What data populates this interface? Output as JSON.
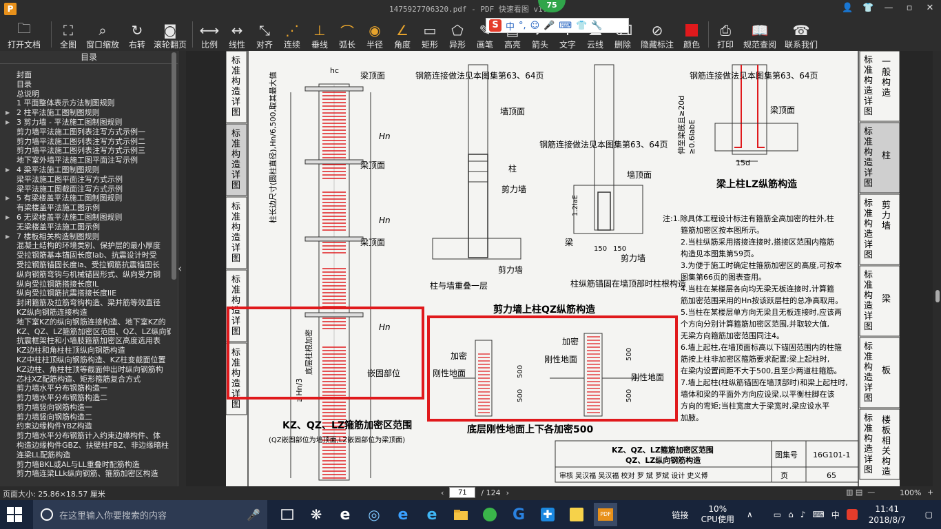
{
  "window": {
    "title": "1475927706320.pdf - PDF 快速看图 v1.9",
    "logo": "P",
    "badge": "75"
  },
  "toolbar": {
    "items": [
      {
        "label": "打开文档",
        "icon": "folder-icon"
      },
      {
        "label": "全图",
        "icon": "fit-icon"
      },
      {
        "label": "窗口缩放",
        "icon": "zoom-icon"
      },
      {
        "label": "右转",
        "icon": "rotate-icon"
      },
      {
        "label": "滚轮翻页",
        "icon": "mouse-icon"
      },
      {
        "label": "比例",
        "icon": "scale-icon"
      },
      {
        "label": "线性",
        "icon": "linear-icon"
      },
      {
        "label": "对齐",
        "icon": "align-icon"
      },
      {
        "label": "连续",
        "icon": "continuous-icon"
      },
      {
        "label": "垂线",
        "icon": "perpendicular-icon"
      },
      {
        "label": "弧长",
        "icon": "arc-icon"
      },
      {
        "label": "半径",
        "icon": "radius-icon"
      },
      {
        "label": "角度",
        "icon": "angle-icon"
      },
      {
        "label": "矩形",
        "icon": "rect-icon"
      },
      {
        "label": "异形",
        "icon": "polygon-icon"
      },
      {
        "label": "画笔",
        "icon": "pen-icon"
      },
      {
        "label": "高亮",
        "icon": "highlight-icon"
      },
      {
        "label": "箭头",
        "icon": "arrow-icon"
      },
      {
        "label": "文字",
        "icon": "text-icon"
      },
      {
        "label": "云线",
        "icon": "cloud-icon"
      },
      {
        "label": "删除",
        "icon": "eraser-icon"
      },
      {
        "label": "隐藏标注",
        "icon": "hide-icon"
      },
      {
        "label": "颜色",
        "icon": "color-icon",
        "color": "#e0191c"
      },
      {
        "label": "打印",
        "icon": "printer-icon"
      },
      {
        "label": "规范查阅",
        "icon": "book-icon"
      },
      {
        "label": "联系我们",
        "icon": "user-icon"
      }
    ]
  },
  "ime": {
    "mode": "中",
    "punct": "°,"
  },
  "sidebar": {
    "title": "目录",
    "items": [
      {
        "text": "封面",
        "indent": 1
      },
      {
        "text": "目录",
        "indent": 1
      },
      {
        "text": "总说明",
        "indent": 1
      },
      {
        "text": "1 平面整体表示方法制图规则",
        "indent": 1
      },
      {
        "text": "2 柱平法施工图制图规则",
        "indent": 1,
        "arrow": true
      },
      {
        "text": "3 剪力墙 - 平法施工图制图规则",
        "indent": 1,
        "arrow": true
      },
      {
        "text": "剪力墙平法施工图列表注写方式示例一",
        "indent": 1
      },
      {
        "text": "剪力墙平法施工图列表注写方式示例二",
        "indent": 1
      },
      {
        "text": "剪力墙平法施工图列表注写方式示例三",
        "indent": 1
      },
      {
        "text": "地下室外墙平法施工图平面注写示例",
        "indent": 1
      },
      {
        "text": "4 梁平法施工图制图规则",
        "indent": 1,
        "arrow": true
      },
      {
        "text": "梁平法施工图平面注写方式示例",
        "indent": 1
      },
      {
        "text": "梁平法施工图截面注写方式示例",
        "indent": 1
      },
      {
        "text": "5 有梁楼盖平法施工图制图规则",
        "indent": 1,
        "arrow": true
      },
      {
        "text": "有梁楼盖平法施工图示例",
        "indent": 1
      },
      {
        "text": "6 无梁楼盖平法施工图制图规则",
        "indent": 1,
        "arrow": true
      },
      {
        "text": "无梁楼盖平法施工图示例",
        "indent": 1
      },
      {
        "text": "7 楼板相关构造制图规则",
        "indent": 1,
        "arrow": true
      },
      {
        "text": "混凝土结构的环境类别、保护层的最小厚度",
        "indent": 1
      },
      {
        "text": "受拉钢筋基本锚固长度lab、抗震设计时受",
        "indent": 1
      },
      {
        "text": "受拉钢筋锚固长度la、受拉钢筋抗震锚固长",
        "indent": 1
      },
      {
        "text": "纵向钢筋弯钩与机械锚固形式、纵向受力钢",
        "indent": 1
      },
      {
        "text": "纵向受拉钢筋搭接长度lL",
        "indent": 1
      },
      {
        "text": "纵向受拉钢筋抗震搭接长度llE",
        "indent": 1
      },
      {
        "text": "封闭箍筋及拉筋弯钩构造、梁并筋等效直径",
        "indent": 1
      },
      {
        "text": "KZ纵向钢筋连接构造",
        "indent": 1
      },
      {
        "text": "地下室KZ的纵向钢筋连接构造、地下室KZ的",
        "indent": 1
      },
      {
        "text": "KZ、QZ、LZ箍筋加密区范围、QZ、LZ纵向钢",
        "indent": 1
      },
      {
        "text": "抗震框架柱和小墙肢箍筋加密区高度选用表",
        "indent": 1
      },
      {
        "text": "KZ边柱和角柱柱顶纵向钢筋构造",
        "indent": 1
      },
      {
        "text": "KZ中柱柱顶纵向钢筋构造、KZ柱变截面位置",
        "indent": 1
      },
      {
        "text": "KZ边柱、角柱柱顶等截面伸出时纵向钢筋构",
        "indent": 1
      },
      {
        "text": "芯柱XZ配筋构造、矩形箍筋复合方式",
        "indent": 1
      },
      {
        "text": "剪力墙水平分布钢筋构造一",
        "indent": 1
      },
      {
        "text": "剪力墙水平分布钢筋构造二",
        "indent": 1
      },
      {
        "text": "剪力墙竖向钢筋构造一",
        "indent": 1
      },
      {
        "text": "剪力墙竖向钢筋构造二",
        "indent": 1
      },
      {
        "text": "约束边缘构件YBZ构造",
        "indent": 1
      },
      {
        "text": "剪力墙水平分布钢筋计入约束边缘构件、体",
        "indent": 1
      },
      {
        "text": "构造边缘构件GBZ、扶壁柱FBZ、非边缘暗柱",
        "indent": 1
      },
      {
        "text": "连梁LL配筋构造",
        "indent": 1
      },
      {
        "text": "剪力墙BKL或AL与LL重叠时配筋构造",
        "indent": 1
      },
      {
        "text": "剪力墙连梁LLk纵向钢筋、箍筋加密区构造",
        "indent": 1
      }
    ]
  },
  "status": {
    "page_size": "页面大小: 25.86×18.57 厘米",
    "current_page": "71",
    "total_pages": "/ 124",
    "zoom": "100%"
  },
  "document": {
    "left_tabs": [
      "标准构造详图",
      "标准构造详图",
      "标准构造详图",
      "标准构造详图",
      "标准构造详图"
    ],
    "right_tabs": [
      {
        "title": "标准构造详图",
        "sub": "一般构造"
      },
      {
        "title": "标准构造详图",
        "sub": "柱"
      },
      {
        "title": "标准构造详图",
        "sub": "剪力墙"
      },
      {
        "title": "标准构造详图",
        "sub": "梁"
      },
      {
        "title": "标准构造详图",
        "sub": "板"
      },
      {
        "title": "标准构造详图",
        "sub": "楼板相关构造"
      }
    ],
    "labels": {
      "hc": "hc",
      "beam_top1": "梁顶面",
      "beam_top2": "梁顶面",
      "beam_top3": "梁顶面",
      "dense": "加密",
      "hn": "Hn",
      "hn3": "≥Hn/3",
      "ground_note": "底层柱根加密",
      "vertical_note": "柱长边尺寸(圆柱直径),Hn/6,500,取其最大值",
      "embed": "嵌固部位",
      "title_left": "KZ、QZ、LZ箍筋加密区范围",
      "sub_left": "(QZ嵌固部位为墙顶面,LZ嵌固部位为梁顶面)",
      "rebar_link1": "钢筋连接做法见本图集第63、64页",
      "wall_top1": "墙顶面",
      "column": "柱",
      "shear_wall1": "剪力墙",
      "shear_wall2": "剪力墙",
      "overlap_note": "柱与墙重叠一层",
      "rebar_link2": "钢筋连接做法见本图集第63、64页",
      "wall_top2": "墙顶面",
      "beam": "梁",
      "anchor_note": "柱纵筋锚固在墙顶部时柱根构造",
      "dim_12lae": "1.2laE",
      "dim_150a": "150",
      "dim_150b": "150",
      "title_mid": "剪力墙上柱QZ纵筋构造",
      "rebar_link3": "钢筋连接做法见本图集第63、64页",
      "beam_top4": "梁顶面",
      "extend_note": "伸至梁底且≥20d",
      "dim_06": "≥0.6labE",
      "dim_15d": "15d",
      "title_right": "梁上柱LZ纵筋构造",
      "dense2": "加密",
      "rigid1": "刚性地面",
      "dense3": "加密",
      "rigid2": "刚性地面",
      "rigid3": "刚性地面",
      "dim500a": "500",
      "dim500b": "500",
      "dim500c": "500",
      "dim500d": "500",
      "title_bottom": "底层刚性地面上下各加密500",
      "tb_title1": "KZ、QZ、LZ箍筋加密区范围",
      "tb_title2": "QZ、LZ纵向钢筋构造",
      "tb_atlas_lbl": "图集号",
      "tb_atlas": "16G101-1",
      "tb_page_lbl": "页",
      "tb_page": "65",
      "tb_row": "审核 吴汉福 吴汉福 校对 罗 斌 罗斌 设计 史义博"
    },
    "notes": [
      "注:1.除具体工程设计标注有箍筋全高加密的柱外,柱",
      "箍筋加密区按本图所示。",
      "2.当柱纵筋采用搭接连接时,搭接区范围内箍筋",
      "构造见本图集第59页。",
      "3.为便于施工时确定柱箍筋加密区的高度,可按本",
      "图集第66页的图表查用。",
      "4.当柱在某楼层各向均无梁无板连接时,计算箍",
      "筋加密范围采用的Hn按该跃层柱的总净高取用。",
      "5.当柱在某楼层单方向无梁且无板连接时,应该两",
      "个方向分别计算箍筋加密区范围,并取较大值,",
      "无梁方向箍筋加密范围同注4。",
      "6.墙上起柱,在墙顶面标高以下锚固范围内的柱箍",
      "筋按上柱非加密区箍筋要求配置;梁上起柱时,",
      "在梁内设置间距不大于500,且至少两道柱箍筋。",
      "7.墙上起柱(柱纵筋锚固在墙顶部时)和梁上起柱时,",
      "墙体和梁的平面外方向应设梁,以平衡柱脚在该",
      "方向的弯矩;当柱宽度大于梁宽时,梁应设水平",
      "加腋。"
    ]
  },
  "taskbar": {
    "search_placeholder": "在这里输入你要搜索的内容",
    "link": "链接",
    "cpu_pct": "10%",
    "cpu_lbl": "CPU使用",
    "ime": "中",
    "time": "11:41",
    "date": "2018/8/7"
  }
}
